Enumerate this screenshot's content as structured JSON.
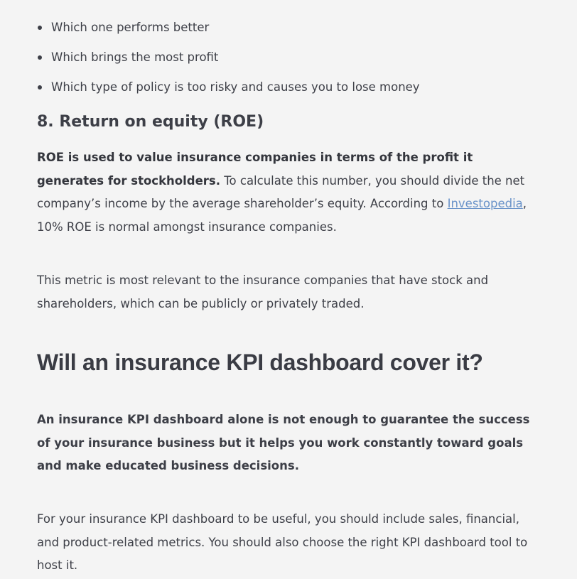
{
  "bullets": [
    "Which one performs better",
    "Which brings the most profit",
    "Which type of policy is too risky and causes you to lose money"
  ],
  "section_heading": "8. Return on equity (ROE)",
  "para1": {
    "bold": "ROE is used to value insurance companies in terms of the profit it generates for stockholders.",
    "text_before_link": " To calculate this number, you should divide the net company’s income by the average shareholder’s equity. According to ",
    "link": "Investopedia",
    "text_after_link": ", 10% ROE is normal amongst insurance companies."
  },
  "para2": "This metric is most relevant to the insurance companies that have stock and shareholders, which can be publicly or privately traded.",
  "main_heading": "Will an insurance KPI dashboard cover it?",
  "para3": "An insurance KPI dashboard alone is not enough to guarantee the success of your insurance business but it helps you work constantly toward goals and make educated business decisions.",
  "para4": "For your insurance KPI dashboard to be useful, you should include sales, financial, and product-related metrics. You should also choose the right KPI dashboard tool to host it."
}
